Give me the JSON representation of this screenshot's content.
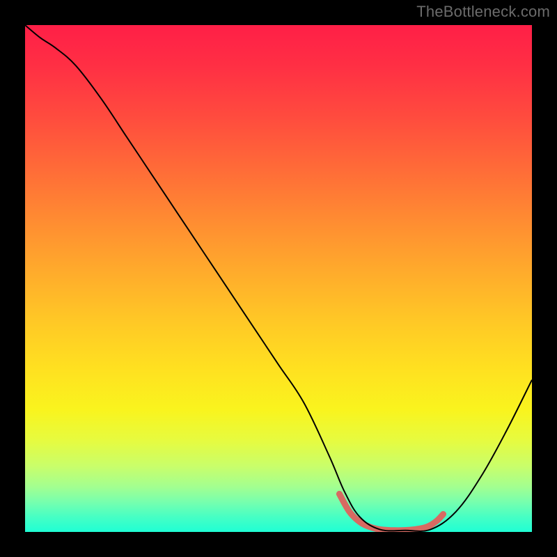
{
  "watermark": "TheBottleneck.com",
  "chart_data": {
    "type": "line",
    "title": "",
    "xlabel": "",
    "ylabel": "",
    "xlim": [
      0,
      100
    ],
    "ylim": [
      0,
      100
    ],
    "series": [
      {
        "name": "curve",
        "x": [
          0,
          3,
          6,
          10,
          15,
          20,
          25,
          30,
          35,
          40,
          45,
          50,
          55,
          60,
          63,
          66,
          70,
          75,
          80,
          85,
          90,
          95,
          100
        ],
        "y": [
          100,
          97.5,
          95.5,
          92,
          85.5,
          78,
          70.5,
          63,
          55.5,
          48,
          40.5,
          33,
          25.5,
          15,
          8,
          3,
          0.5,
          0.3,
          0.5,
          4,
          11,
          20,
          30
        ],
        "color": "#000000",
        "width": 2.0
      },
      {
        "name": "highlight",
        "x": [
          62,
          64,
          66,
          68,
          70,
          73,
          76,
          79,
          81,
          82.5
        ],
        "y": [
          7.5,
          4.0,
          2.0,
          1.0,
          0.5,
          0.3,
          0.4,
          0.9,
          2.0,
          3.5
        ],
        "color": "#d76a62",
        "width": 9
      }
    ],
    "gradient_stops": [
      {
        "pos": 0,
        "color": "#ff1f47"
      },
      {
        "pos": 18,
        "color": "#ff4b3e"
      },
      {
        "pos": 38,
        "color": "#ff8a32"
      },
      {
        "pos": 58,
        "color": "#ffc726"
      },
      {
        "pos": 76,
        "color": "#f9f41e"
      },
      {
        "pos": 91,
        "color": "#a4ff8f"
      },
      {
        "pos": 100,
        "color": "#1fffd4"
      }
    ]
  }
}
